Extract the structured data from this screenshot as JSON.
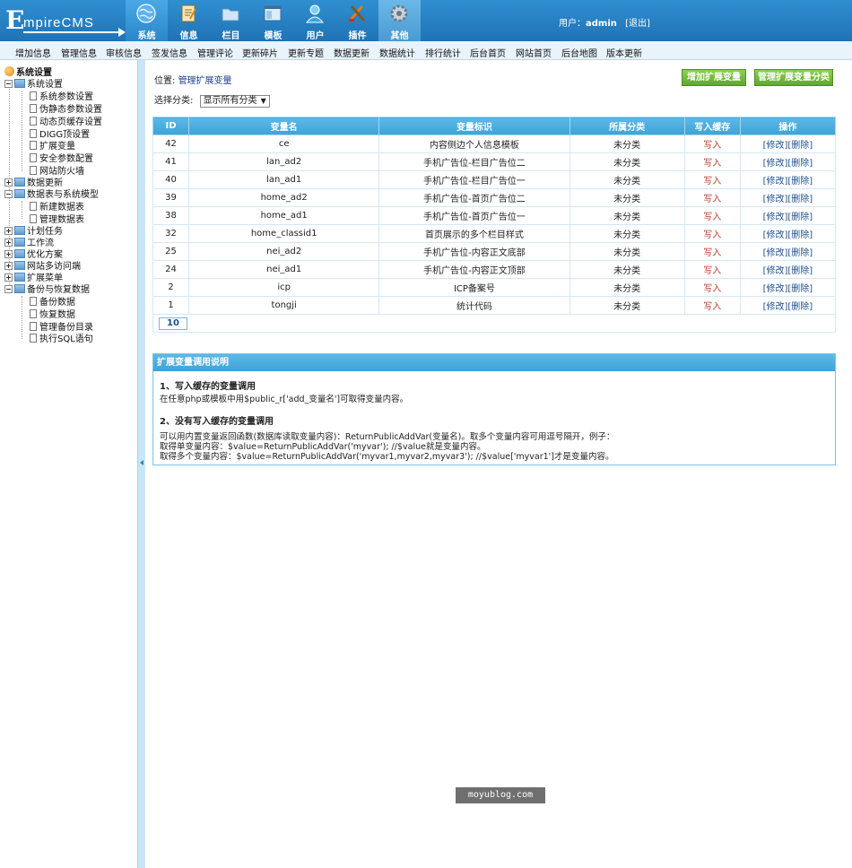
{
  "app": {
    "logo_initial": "E",
    "logo_rest": "mpireCMS"
  },
  "nav": [
    {
      "label": "系统",
      "icon": "globe-icon"
    },
    {
      "label": "信息",
      "icon": "document-icon"
    },
    {
      "label": "栏目",
      "icon": "folder-icon"
    },
    {
      "label": "模板",
      "icon": "template-window-icon"
    },
    {
      "label": "用户",
      "icon": "user-icon"
    },
    {
      "label": "插件",
      "icon": "tools-icon"
    },
    {
      "label": "其他",
      "icon": "gear-icon"
    }
  ],
  "user": {
    "prefix": "用户：",
    "name": "admin",
    "logout": "[退出]"
  },
  "menubar": [
    "增加信息",
    "管理信息",
    "审核信息",
    "签发信息",
    "管理评论",
    "更新碎片",
    "更新专题",
    "数据更新",
    "数据统计",
    "排行统计",
    "后台首页",
    "网站首页",
    "后台地图",
    "版本更新"
  ],
  "sidebar": {
    "root": "系统设置",
    "items": [
      "系统设置",
      "系统参数设置",
      "伪静态参数设置",
      "动态页缓存设置",
      "DIGG顶设置",
      "扩展变量",
      "安全参数配置",
      "网站防火墙",
      "数据更新",
      "数据表与系统模型",
      "新建数据表",
      "管理数据表",
      "计划任务",
      "工作流",
      "优化方案",
      "网站多访问端",
      "扩展菜单",
      "备份与恢复数据",
      "备份数据",
      "恢复数据",
      "管理备份目录",
      "执行SQL语句"
    ]
  },
  "main": {
    "position_label": "位置:",
    "position_link": "管理扩展变量",
    "add_button": "增加扩展变量",
    "manage_class_button": "管理扩展变量分类",
    "select_label": "选择分类:",
    "select_value": "显示所有分类",
    "table": {
      "headers": [
        "ID",
        "变量名",
        "变量标识",
        "所属分类",
        "写入缓存",
        "操作"
      ],
      "rows": [
        {
          "id": "42",
          "name": "ce",
          "label": "内容侧边个人信息模板",
          "category": "未分类",
          "write": "写入",
          "edit": "[修改]",
          "del": "[删除]"
        },
        {
          "id": "41",
          "name": "lan_ad2",
          "label": "手机广告位-栏目广告位二",
          "category": "未分类",
          "write": "写入",
          "edit": "[修改]",
          "del": "[删除]"
        },
        {
          "id": "40",
          "name": "lan_ad1",
          "label": "手机广告位-栏目广告位一",
          "category": "未分类",
          "write": "写入",
          "edit": "[修改]",
          "del": "[删除]"
        },
        {
          "id": "39",
          "name": "home_ad2",
          "label": "手机广告位-首页广告位二",
          "category": "未分类",
          "write": "写入",
          "edit": "[修改]",
          "del": "[删除]"
        },
        {
          "id": "38",
          "name": "home_ad1",
          "label": "手机广告位-首页广告位一",
          "category": "未分类",
          "write": "写入",
          "edit": "[修改]",
          "del": "[删除]"
        },
        {
          "id": "32",
          "name": "home_classid1",
          "label": "首页展示的多个栏目样式",
          "category": "未分类",
          "write": "写入",
          "edit": "[修改]",
          "del": "[删除]"
        },
        {
          "id": "25",
          "name": "nei_ad2",
          "label": "手机广告位-内容正文底部",
          "category": "未分类",
          "write": "写入",
          "edit": "[修改]",
          "del": "[删除]"
        },
        {
          "id": "24",
          "name": "nei_ad1",
          "label": "手机广告位-内容正文顶部",
          "category": "未分类",
          "write": "写入",
          "edit": "[修改]",
          "del": "[删除]"
        },
        {
          "id": "2",
          "name": "icp",
          "label": "ICP备案号",
          "category": "未分类",
          "write": "写入",
          "edit": "[修改]",
          "del": "[删除]"
        },
        {
          "id": "1",
          "name": "tongji",
          "label": "统计代码",
          "category": "未分类",
          "write": "写入",
          "edit": "[修改]",
          "del": "[删除]"
        }
      ],
      "pager": "10"
    },
    "info": {
      "title": "扩展变量调用说明",
      "h1": "1、写入缓存的变量调用",
      "t1": "在任意php或模板中用$public_r['add_变量名']可取得变量内容。",
      "h2": "2、没有写入缓存的变量调用",
      "t2": "可以用内置变量返回函数(数据库读取变量内容)：ReturnPublicAddVar(变量名)。取多个变量内容可用逗号隔开，例子：",
      "t3": "取得单变量内容：$value=ReturnPublicAddVar('myvar'); //$value就是变量内容。",
      "t4": "取得多个变量内容：$value=ReturnPublicAddVar('myvar1,myvar2,myvar3'); //$value['myvar1']才是变量内容。"
    }
  },
  "watermark": "moyublog.com"
}
